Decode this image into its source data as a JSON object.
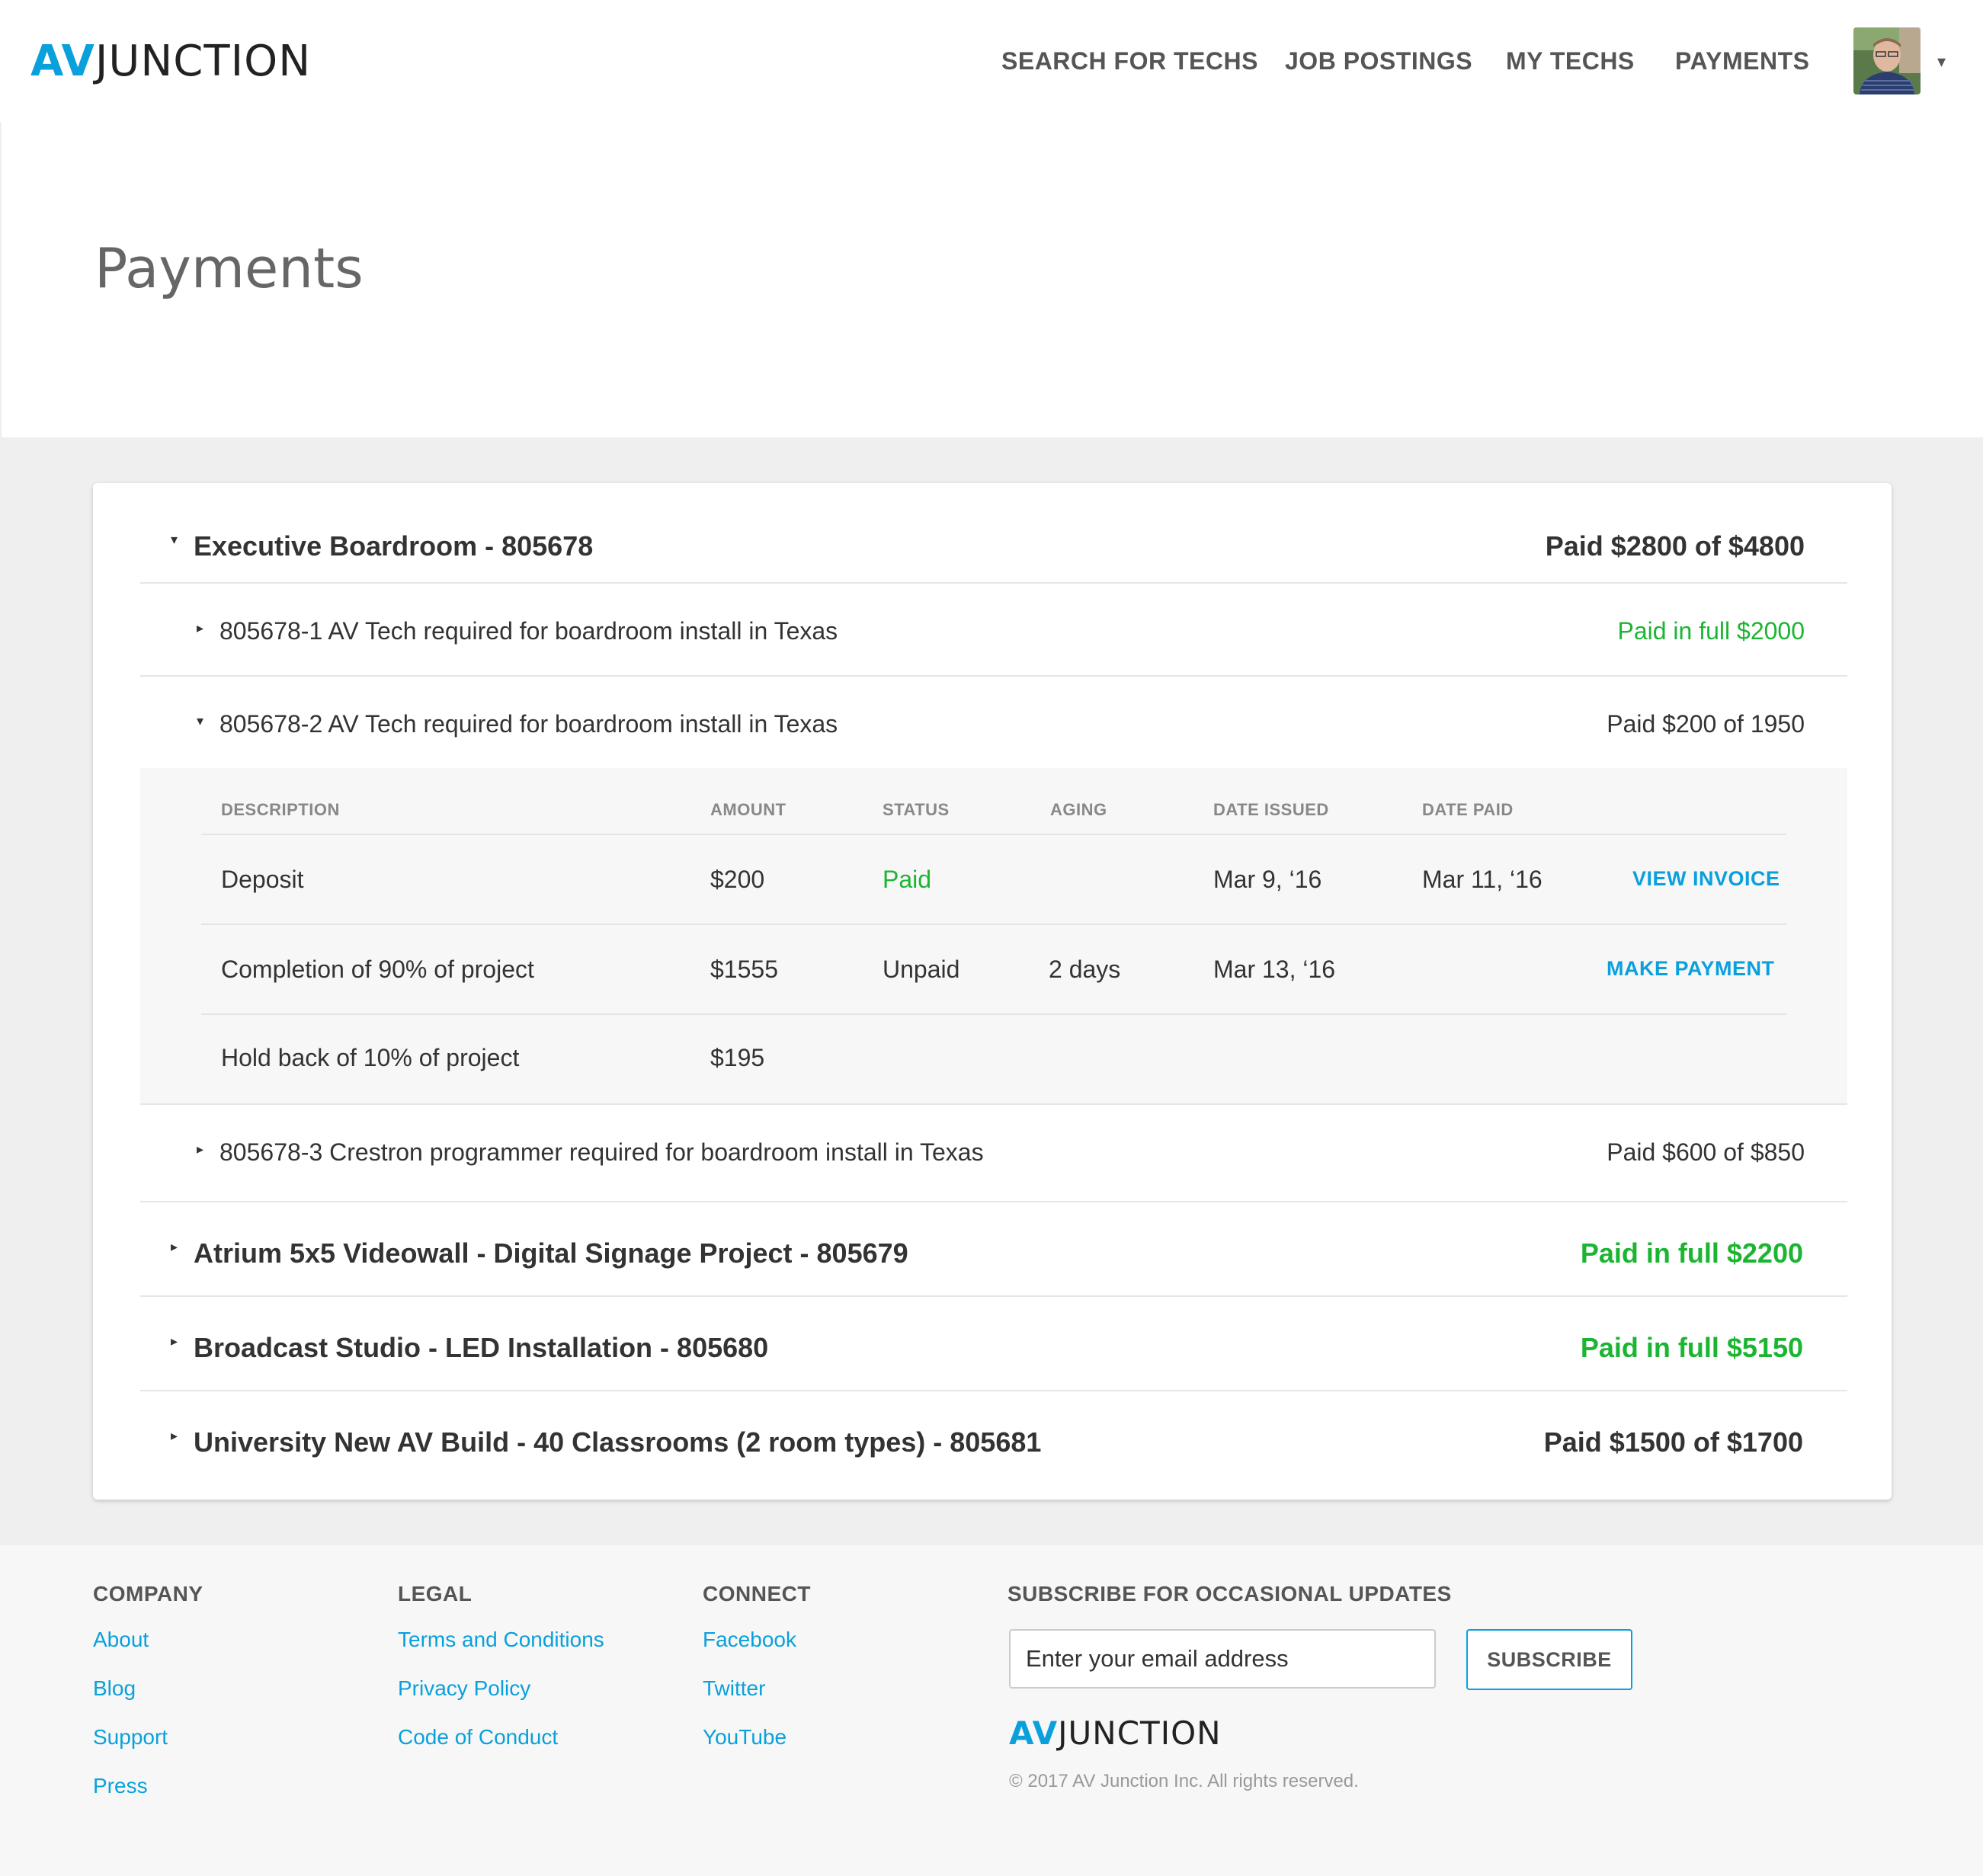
{
  "header": {
    "logo_av": "AV",
    "logo_junction": "JUNCTION",
    "nav": [
      {
        "label": "SEARCH FOR TECHS"
      },
      {
        "label": "JOB POSTINGS"
      },
      {
        "label": "MY TECHS"
      },
      {
        "label": "PAYMENTS"
      }
    ],
    "caret": "▾"
  },
  "page": {
    "title": "Payments"
  },
  "projects": [
    {
      "title": "Executive Boardroom - 805678",
      "status": "Paid $2800 of $4800",
      "expanded": true,
      "caret": "▾",
      "jobs": [
        {
          "title": "805678-1 AV Tech required for boardroom install in Texas",
          "status": "Paid in full $2000",
          "caret": "▸"
        },
        {
          "title": "805678-2 AV Tech required for boardroom install in Texas",
          "status": "Paid $200 of 1950",
          "caret": "▾"
        },
        {
          "title": "805678-3 Crestron programmer required for boardroom install in Texas",
          "status": "Paid $600 of $850",
          "caret": "▸"
        }
      ]
    },
    {
      "title": "Atrium 5x5 Videowall - Digital Signage Project - 805679",
      "status": "Paid in full $2200",
      "caret": "▸"
    },
    {
      "title": "Broadcast Studio - LED Installation - 805680",
      "status": "Paid in full $5150",
      "caret": "▸"
    },
    {
      "title": "University New AV Build - 40 Classrooms (2 room types) - 805681",
      "status": "Paid $1500 of $1700",
      "caret": "▸"
    }
  ],
  "payment_table": {
    "headers": [
      "DESCRIPTION",
      "AMOUNT",
      "STATUS",
      "AGING",
      "DATE ISSUED",
      "DATE PAID"
    ],
    "rows": [
      {
        "description": "Deposit",
        "amount": "$200",
        "status": "Paid",
        "aging": "",
        "date_issued": "Mar 9, ‘16",
        "date_paid": "Mar 11, ‘16",
        "action": "VIEW INVOICE"
      },
      {
        "description": "Completion of 90% of project",
        "amount": "$1555",
        "status": "Unpaid",
        "aging": "2 days",
        "date_issued": "Mar 13, ‘16",
        "date_paid": "",
        "action": "MAKE PAYMENT"
      },
      {
        "description": "Hold back of 10% of project",
        "amount": "$195",
        "status": "",
        "aging": "",
        "date_issued": "",
        "date_paid": "",
        "action": ""
      }
    ]
  },
  "footer": {
    "company": {
      "heading": "COMPANY",
      "links": [
        "About",
        "Blog",
        "Support",
        "Press"
      ]
    },
    "legal": {
      "heading": "LEGAL",
      "links": [
        "Terms and Conditions",
        "Privacy Policy",
        "Code of Conduct"
      ]
    },
    "connect": {
      "heading": "CONNECT",
      "links": [
        "Facebook",
        "Twitter",
        "YouTube"
      ]
    },
    "subscribe": {
      "heading": "SUBSCRIBE FOR OCCASIONAL UPDATES",
      "placeholder": "Enter your email address",
      "button": "SUBSCRIBE"
    },
    "logo_av": "AV",
    "logo_junction": "JUNCTION",
    "copyright": "© 2017 AV Junction Inc. All rights reserved."
  },
  "colors": {
    "accent": "#0aa0dc",
    "paid_green": "#1cb532",
    "background_gray": "#efefef"
  }
}
